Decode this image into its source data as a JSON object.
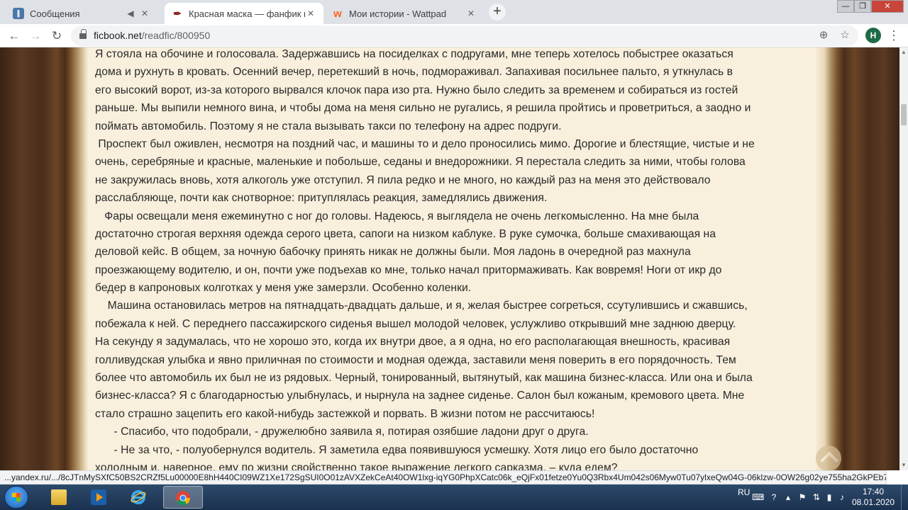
{
  "browser": {
    "tabs": [
      {
        "label": "Сообщения",
        "active": false,
        "icon": "vk-icon"
      },
      {
        "label": "Красная маска — фанфик по ф",
        "active": true,
        "icon": "ficbook-icon"
      },
      {
        "label": "Мои истории - Wattpad",
        "active": false,
        "icon": "wattpad-icon"
      }
    ],
    "new_tab": "+",
    "window_controls": {
      "minimize": "—",
      "maximize": "❐",
      "close": "✕"
    },
    "url_host": "ficbook.net",
    "url_path": "/readfic/800950",
    "avatar_letter": "H",
    "status_url": "...yandex.ru/.../8cJTnMySXfC50BS2CRZf5Lu00000E8hH440CI09WZ1Xe172SgSUI0O01zAVXZekCeAt40OW1lxg-iqYG0PhpXCatc06k_eQjFx01fetze0Yu0Q3Rbx4Um042s06Myw0Tu07ylxeQw04G-06klzw-0OW26g02ye755ha2GkPEb74typpm0ktcwalu0eA0..."
  },
  "story": {
    "lines": [
      "Я стояла на обочине и голосовала. Задержавшись на посиделках с подругами, мне теперь хотелось побыстрее оказаться",
      "дома и рухнуть в кровать. Осенний вечер, перетекший в ночь, подмораживал. Запахивая посильнее пальто, я уткнулась в",
      "его высокий ворот, из-за которого вырвался клочок пара изо рта. Нужно было следить за временем и собираться из гостей",
      "раньше. Мы выпили немного вина, и чтобы дома на меня сильно не ругались, я решила пройтись и проветриться, а заодно и",
      "поймать автомобиль. Поэтому я не стала вызывать такси по телефону на адрес подруги.",
      " Проспект был оживлен, несмотря на поздний час, и машины то и дело проносились мимо. Дорогие и блестящие, чистые и не",
      "очень, серебряные и красные, маленькие и побольше, седаны и внедорожники. Я перестала следить за ними, чтобы голова",
      "не закружилась вновь, хотя алкоголь уже отступил. Я пила редко и не много, но каждый раз на меня это действовало",
      "расслабляюще, почти как снотворное: притуплялась реакция, замедлялись движения.",
      "   Фары освещали меня ежеминутно с ног до головы. Надеюсь, я выглядела не очень легкомысленно. На мне была",
      "достаточно строгая верхняя одежда серого цвета, сапоги на низком каблуке. В руке сумочка, больше смахивающая на",
      "деловой кейс. В общем, за ночную бабочку принять никак не должны были. Моя ладонь в очередной раз махнула",
      "проезжающему водителю, и он, почти уже подъехав ко мне, только начал притормаживать. Как вовремя! Ноги от икр до",
      "бедер в капроновых колготках у меня уже замерзли. Особенно коленки.",
      "    Машина остановилась метров на пятнадцать-двадцать дальше, и я, желая быстрее согреться, ссутулившись и сжавшись,",
      "побежала к ней. С переднего пассажирского сиденья вышел молодой человек, услужливо открывший мне заднюю дверцу.",
      "На секунду я задумалась, что не хорошо это, когда их внутри двое, а я одна, но его располагающая внешность, красивая",
      "голливудская улыбка и явно приличная по стоимости и модная одежда, заставили меня поверить в его порядочность. Тем",
      "более что автомобиль их был не из рядовых. Черный, тонированный, вытянутый, как машина бизнес-класса. Или она и была",
      "бизнес-класса? Я с благодарностью улыбнулась, и нырнула на заднее сиденье. Салон был кожаным, кремового цвета. Мне",
      "стало страшно зацепить его какой-нибудь застежкой и порвать. В жизни потом не рассчитаюсь!",
      "      - Спасибо, что подобрали, - дружелюбно заявила я, потирая озябшие ладони друг о друга.",
      "      - Не за что, - полуобернулся водитель. Я заметила едва появившуюся усмешку. Хотя лицо его было достаточно",
      "холодным и, наверное, ему по жизни свойственно такое выражение легкого сарказма. – куда едем?"
    ]
  },
  "taskbar": {
    "language": "RU",
    "time": "17:40",
    "date": "08.01.2020"
  },
  "colors": {
    "page_bg": "#f8efdc",
    "frame_wood": "#4a2d18",
    "avatar_bg": "#1e6b45"
  }
}
